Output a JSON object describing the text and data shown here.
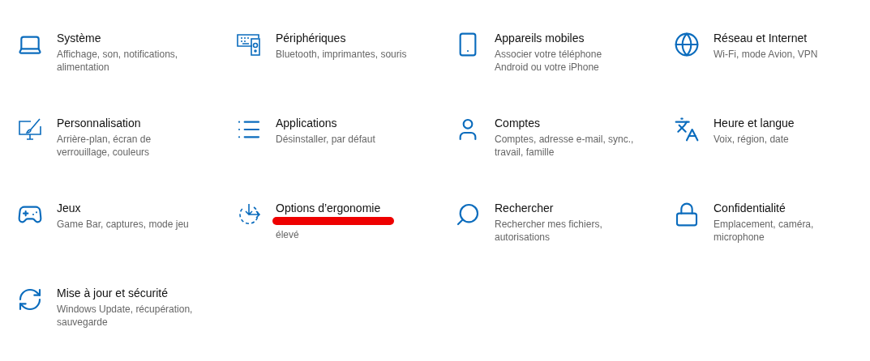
{
  "categories": [
    {
      "title": "Système",
      "description": "Affichage, son, notifications, alimentation",
      "underlined": false
    },
    {
      "title": "Périphériques",
      "description": "Bluetooth, imprimantes, souris",
      "underlined": false
    },
    {
      "title": "Appareils mobiles",
      "description": "Associer votre téléphone Android ou votre iPhone",
      "underlined": false
    },
    {
      "title": "Réseau et Internet",
      "description": "Wi-Fi, mode Avion, VPN",
      "underlined": false
    },
    {
      "title": "Personnalisation",
      "description": "Arrière-plan, écran de verrouillage, couleurs",
      "underlined": false
    },
    {
      "title": "Applications",
      "description": "Désinstaller, par défaut",
      "underlined": false
    },
    {
      "title": "Comptes",
      "description": "Comptes, adresse e-mail, sync., travail, famille",
      "underlined": false
    },
    {
      "title": "Heure et langue",
      "description": "Voix, région, date",
      "underlined": false
    },
    {
      "title": "Jeux",
      "description": "Game Bar, captures, mode jeu",
      "underlined": false
    },
    {
      "title": "Options d’ergonomie",
      "description": "élevé",
      "underlined": true
    },
    {
      "title": "Rechercher",
      "description": "Rechercher mes fichiers, autorisations",
      "underlined": false
    },
    {
      "title": "Confidentialité",
      "description": "Emplacement, caméra, microphone",
      "underlined": false
    },
    {
      "title": "Mise à jour et sécurité",
      "description": "Windows Update, récupération, sauvegarde",
      "underlined": false
    }
  ]
}
